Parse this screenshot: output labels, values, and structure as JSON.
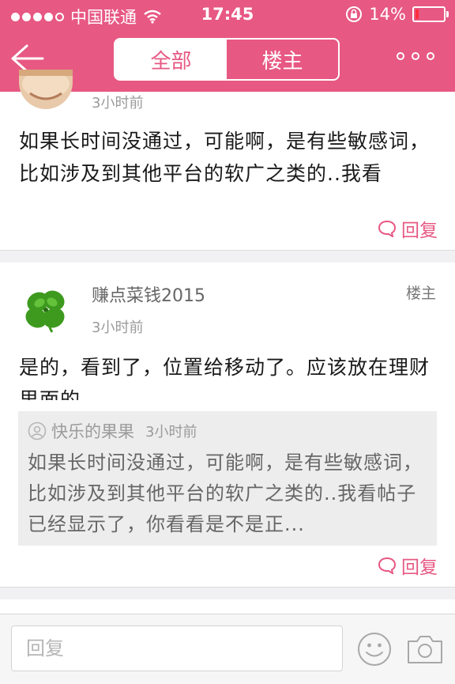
{
  "status_bar": {
    "carrier": "中国联通",
    "time": "17:45",
    "battery": "14%",
    "battery_level": 0.14
  },
  "nav": {
    "tabs": [
      {
        "label": "全部",
        "active": true
      },
      {
        "label": "楼主",
        "active": false
      }
    ],
    "accent_color": "#e75883"
  },
  "posts": [
    {
      "time": "3小时前",
      "text": "如果长时间没通过，可能啊，是有些敏感词，比如涉及到其他平台的软广之类的..我看",
      "reply_label": "回复"
    },
    {
      "username": "赚点菜钱2015",
      "tag": "楼主",
      "time": "3小时前",
      "text": "是的，看到了，位置给移动了。应该放在理财里面的",
      "quote": {
        "user": "快乐的果果",
        "time": "3小时前",
        "text": "如果长时间没通过，可能啊，是有些敏感词，比如涉及到其他平台的软广之类的..我看帖子已经显示了，你看看是不是正..."
      },
      "reply_label": "回复"
    }
  ],
  "bottom_bar": {
    "input_placeholder": "回复",
    "icons": [
      "emoji-icon",
      "camera-icon"
    ]
  }
}
